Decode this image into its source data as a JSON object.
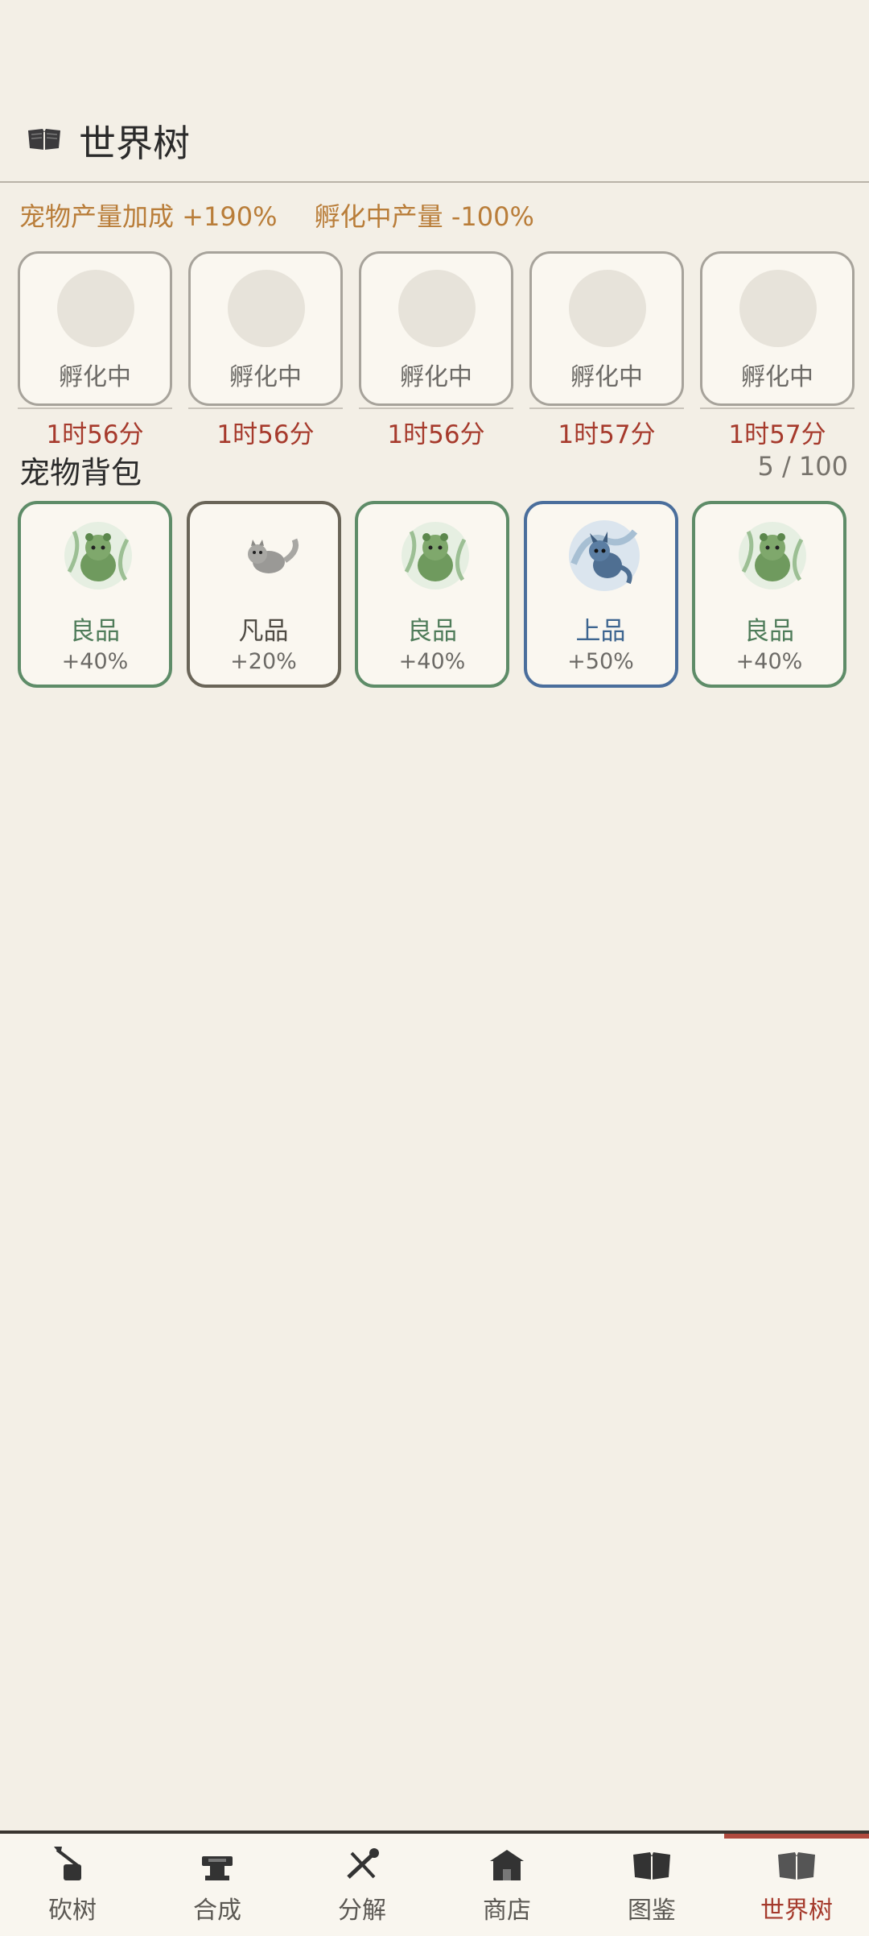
{
  "header": {
    "title": "世界树",
    "icon": "book-icon"
  },
  "stats": {
    "pet_bonus": "宠物产量加成 +190%",
    "hatching_penalty": "孵化中产量 -100%"
  },
  "hatchery": {
    "slots": [
      {
        "status": "孵化中",
        "timer": "1时56分"
      },
      {
        "status": "孵化中",
        "timer": "1时56分"
      },
      {
        "status": "孵化中",
        "timer": "1时56分"
      },
      {
        "status": "孵化中",
        "timer": "1时57分"
      },
      {
        "status": "孵化中",
        "timer": "1时57分"
      }
    ]
  },
  "bag": {
    "title": "宠物背包",
    "count": "5 / 100",
    "pets": [
      {
        "grade": "良品",
        "bonus": "+40%",
        "icon": "green-cat-icon"
      },
      {
        "grade": "凡品",
        "bonus": "+20%",
        "icon": "grey-cat-icon"
      },
      {
        "grade": "良品",
        "bonus": "+40%",
        "icon": "green-cat-icon"
      },
      {
        "grade": "上品",
        "bonus": "+50%",
        "icon": "blue-dragon-icon"
      },
      {
        "grade": "良品",
        "bonus": "+40%",
        "icon": "green-cat-icon"
      }
    ]
  },
  "nav": {
    "items": [
      {
        "label": "砍树",
        "icon": "axe-stump-icon"
      },
      {
        "label": "合成",
        "icon": "anvil-icon"
      },
      {
        "label": "分解",
        "icon": "tools-icon"
      },
      {
        "label": "商店",
        "icon": "shop-icon"
      },
      {
        "label": "图鉴",
        "icon": "book-icon"
      },
      {
        "label": "世界树",
        "icon": "book-icon"
      }
    ],
    "active": "世界树"
  },
  "colors": {
    "background": "#f3efe6",
    "accent_red": "#a63a2c",
    "stat_orange": "#b97d39",
    "grade_good": "#5e8c68",
    "grade_common": "#6a6558",
    "grade_fine": "#4a6e9c"
  }
}
